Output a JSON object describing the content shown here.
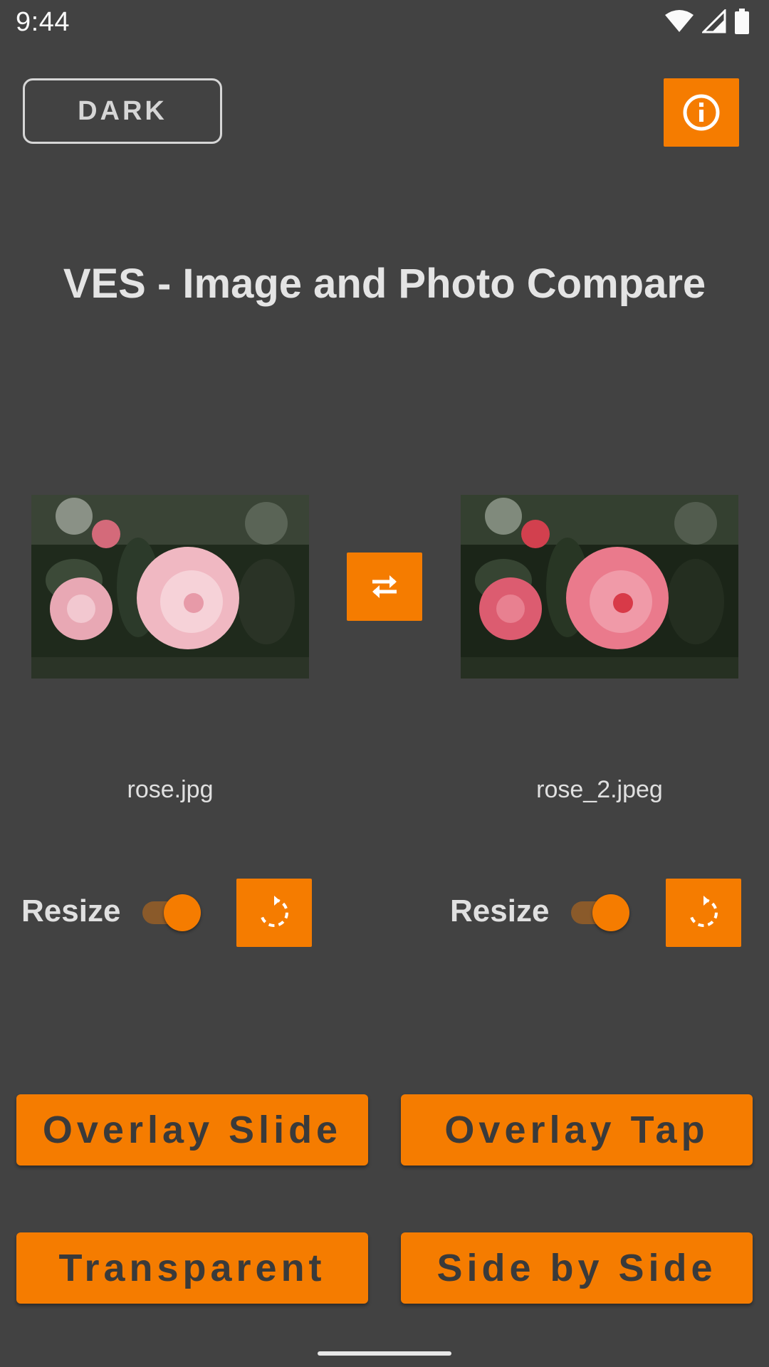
{
  "status_bar": {
    "time": "9:44",
    "icons": [
      "wifi-icon",
      "signal-icon",
      "battery-icon"
    ]
  },
  "header": {
    "theme_toggle_label": "DARK",
    "info_icon": "info-icon"
  },
  "app_title": "VES - Image and Photo Compare",
  "images": {
    "left": {
      "filename": "rose.jpg"
    },
    "right": {
      "filename": "rose_2.jpeg"
    },
    "swap_icon": "swap-horizontal-icon"
  },
  "controls": {
    "left": {
      "resize_label": "Resize",
      "resize_on": true,
      "rotate_icon": "rotate-icon"
    },
    "right": {
      "resize_label": "Resize",
      "resize_on": true,
      "rotate_icon": "rotate-icon"
    }
  },
  "modes": {
    "overlay_slide": "Overlay Slide",
    "overlay_tap": "Overlay Tap",
    "transparent": "Transparent",
    "side_by_side": "Side by Side"
  },
  "colors": {
    "accent": "#f57c00",
    "background": "#424242"
  }
}
